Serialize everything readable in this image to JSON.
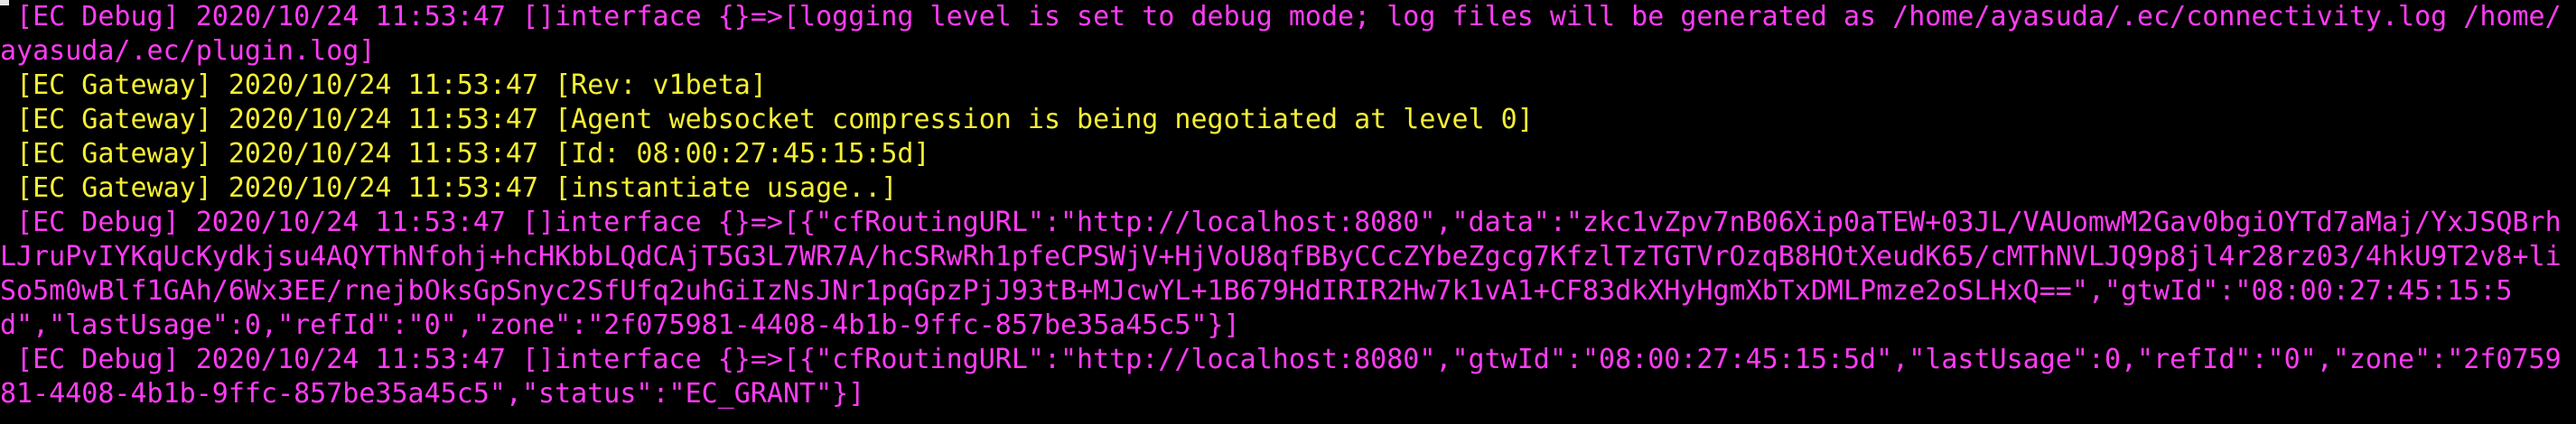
{
  "terminal": {
    "colors": {
      "background": "#000000",
      "debug": "#ff3cf5",
      "gateway": "#f5ef35",
      "cursor": "#e6e6e6"
    },
    "lines": [
      {
        "kind": "debug",
        "text": " [EC Debug] 2020/10/24 11:53:47 []interface {}=>[logging level is set to debug mode; log files will be generated as /home/ayasuda/.ec/connectivity.log /home/ayasuda/.ec/plugin.log]"
      },
      {
        "kind": "gateway",
        "text": " [EC Gateway] 2020/10/24 11:53:47 [Rev: v1beta]"
      },
      {
        "kind": "gateway",
        "text": " [EC Gateway] 2020/10/24 11:53:47 [Agent websocket compression is being negotiated at level 0]"
      },
      {
        "kind": "gateway",
        "text": " [EC Gateway] 2020/10/24 11:53:47 [Id: 08:00:27:45:15:5d]"
      },
      {
        "kind": "gateway",
        "text": " [EC Gateway] 2020/10/24 11:53:47 [instantiate usage..]"
      },
      {
        "kind": "debug",
        "text": " [EC Debug] 2020/10/24 11:53:47 []interface {}=>[{\"cfRoutingURL\":\"http://localhost:8080\",\"data\":\"zkc1vZpv7nB06Xip0aTEW+03JL/VAUomwM2Gav0bgiOYTd7aMaj/YxJSQBrhLJruPvIYKqUcKydkjsu4AQYThNfohj+hcHKbbLQdCAjT5G3L7WR7A/hcSRwRh1pfeCPSWjV+HjVoU8qfBByCCcZYbeZgcg7KfzlTzTGTVrOzqB8HOtXeudK65/cMThNVLJQ9p8jl4r28rz03/4hkU9T2v8+liSo5m0wBlf1GAh/6Wx3EE/rnejbOksGpSnyc2SfUfq2uhGiIzNsJNr1pqGpzPjJ93tB+MJcwYL+1B679HdIRIR2Hw7k1vA1+CF83dkXHyHgmXbTxDMLPmze2oSLHxQ==\",\"gtwId\":\"08:00:27:45:15:5d\",\"lastUsage\":0,\"refId\":\"0\",\"zone\":\"2f075981-4408-4b1b-9ffc-857be35a45c5\"}]"
      },
      {
        "kind": "debug",
        "text": " [EC Debug] 2020/10/24 11:53:47 []interface {}=>[{\"cfRoutingURL\":\"http://localhost:8080\",\"gtwId\":\"08:00:27:45:15:5d\",\"lastUsage\":0,\"refId\":\"0\",\"zone\":\"2f075981-4408-4b1b-9ffc-857be35a45c5\",\"status\":\"EC_GRANT\"}]"
      }
    ]
  }
}
